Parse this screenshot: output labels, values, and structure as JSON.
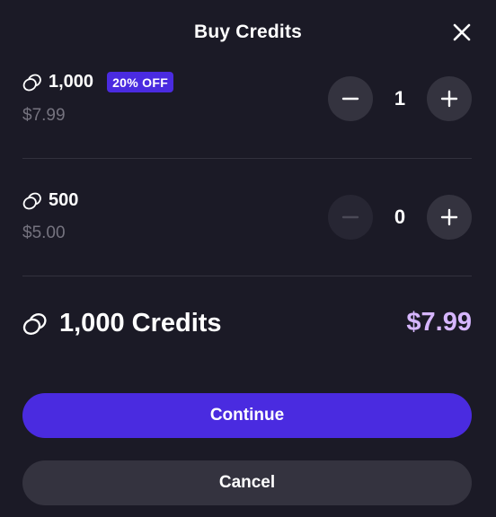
{
  "dialog": {
    "title": "Buy Credits"
  },
  "packages": [
    {
      "amount": "1,000",
      "badge": "20% OFF",
      "price": "$7.99",
      "quantity": "1"
    },
    {
      "amount": "500",
      "price": "$5.00",
      "quantity": "0"
    }
  ],
  "total": {
    "label": "1,000 Credits",
    "price": "$7.99"
  },
  "actions": {
    "continue_label": "Continue",
    "cancel_label": "Cancel"
  },
  "icons": {
    "close": "close-icon",
    "coin": "coins-icon",
    "minus": "minus-icon",
    "plus": "plus-icon"
  },
  "colors": {
    "background": "#1b1a26",
    "accent": "#4a2be0",
    "total_price": "#d6b6ff",
    "muted_text": "#75737f",
    "button_secondary": "#34333f"
  }
}
